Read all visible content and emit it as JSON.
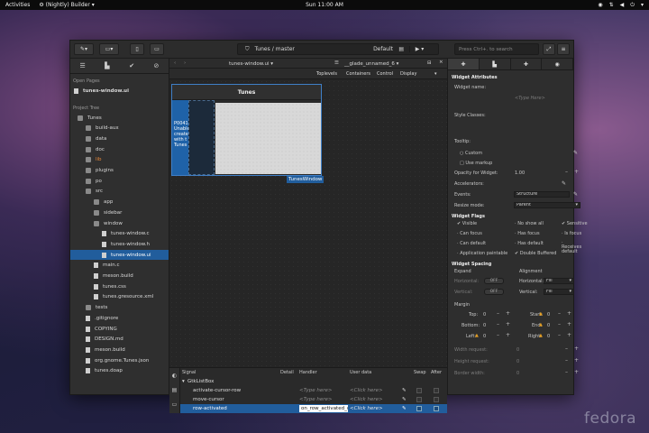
{
  "topbar": {
    "activities": "Activities",
    "app_menu": "(Nightly) Builder",
    "clock": "Sun 11:00 AM"
  },
  "headerbar": {
    "project": "Tunes",
    "branch": "master",
    "build_profile": "Default",
    "search_placeholder": "Press Ctrl+. to search"
  },
  "sidebar": {
    "open_pages_label": "Open Pages",
    "open_page": "tunes-window.ui",
    "project_tree_label": "Project Tree",
    "tree": [
      {
        "label": "Tunes",
        "kind": "folder",
        "indent": 0
      },
      {
        "label": "build-aux",
        "kind": "folder",
        "indent": 1
      },
      {
        "label": "data",
        "kind": "folder",
        "indent": 1
      },
      {
        "label": "doc",
        "kind": "folder",
        "indent": 1
      },
      {
        "label": "lib",
        "kind": "folder",
        "indent": 1,
        "highlight": true
      },
      {
        "label": "plugins",
        "kind": "folder",
        "indent": 1
      },
      {
        "label": "po",
        "kind": "folder",
        "indent": 1
      },
      {
        "label": "src",
        "kind": "folder",
        "indent": 1
      },
      {
        "label": "app",
        "kind": "folder",
        "indent": 2
      },
      {
        "label": "sidebar",
        "kind": "folder",
        "indent": 2
      },
      {
        "label": "window",
        "kind": "folder",
        "indent": 2
      },
      {
        "label": "tunes-window.c",
        "kind": "file",
        "indent": 3
      },
      {
        "label": "tunes-window.h",
        "kind": "file",
        "indent": 3
      },
      {
        "label": "tunes-window.ui",
        "kind": "file",
        "indent": 3,
        "selected": true
      },
      {
        "label": "main.c",
        "kind": "file",
        "indent": 2
      },
      {
        "label": "meson.build",
        "kind": "file",
        "indent": 2
      },
      {
        "label": "tunes.css",
        "kind": "file",
        "indent": 2
      },
      {
        "label": "tunes.gresource.xml",
        "kind": "file",
        "indent": 2
      },
      {
        "label": "tests",
        "kind": "folder",
        "indent": 1
      },
      {
        "label": ".gitignore",
        "kind": "file",
        "indent": 1
      },
      {
        "label": "COPYING",
        "kind": "file",
        "indent": 1
      },
      {
        "label": "DESIGN.md",
        "kind": "file",
        "indent": 1
      },
      {
        "label": "meson.build",
        "kind": "file",
        "indent": 1
      },
      {
        "label": "org.gnome.Tunes.json",
        "kind": "file",
        "indent": 1
      },
      {
        "label": "tunes.doap",
        "kind": "file",
        "indent": 1
      }
    ]
  },
  "editor": {
    "file_tab": "tunes-window.ui",
    "object_tab": "__glade_unnamed_6",
    "toolbar": [
      "Toplevels",
      "Containers",
      "Control",
      "Display"
    ],
    "preview_title": "Tunes",
    "preview_left_text": [
      "P0041",
      "Unable",
      "create",
      "with t",
      "Tunes"
    ],
    "preview_tag": "TunesWindow"
  },
  "signals": {
    "headers": [
      "Signal",
      "Detail",
      "Handler",
      "User data",
      "Swap",
      "After"
    ],
    "group": "GtkListBox",
    "rows": [
      {
        "signal": "activate-cursor-row",
        "handler": "<Type here>",
        "user_data": "<Click here>",
        "selected": false
      },
      {
        "signal": "move-cursor",
        "handler": "<Type here>",
        "user_data": "<Click here>",
        "selected": false
      },
      {
        "signal": "row-activated",
        "handler": "on_row_activated_cb",
        "user_data": "<Click here>",
        "selected": true
      }
    ]
  },
  "properties": {
    "title": "Widget Attributes",
    "widget_name_label": "Widget name:",
    "widget_name_placeholder": "<Type Here>",
    "style_classes_label": "Style Classes:",
    "tooltip_label": "Tooltip:",
    "custom_label": "Custom",
    "use_markup_label": "Use markup",
    "opacity_label": "Opacity for Widget:",
    "opacity_value": "1.00",
    "accelerators_label": "Accelerators:",
    "events_label": "Events:",
    "events_value": "Structure",
    "resize_label": "Resize mode:",
    "resize_value": "Parent",
    "flags_title": "Widget Flags",
    "flags": [
      {
        "label": "Visible",
        "checked": true
      },
      {
        "label": "No show all",
        "checked": false
      },
      {
        "label": "Sensitive",
        "checked": true
      },
      {
        "label": "Can focus",
        "checked": false
      },
      {
        "label": "Has focus",
        "checked": false
      },
      {
        "label": "Is focus",
        "checked": false
      },
      {
        "label": "Can default",
        "checked": false
      },
      {
        "label": "Has default",
        "checked": false
      },
      {
        "label": "Receives default",
        "checked": false
      },
      {
        "label": "Application paintable",
        "checked": false
      },
      {
        "label": "Double Buffered",
        "checked": true
      }
    ],
    "spacing_title": "Widget Spacing",
    "expand_label": "Expand",
    "alignment_label": "Alignment",
    "horizontal_label": "Horizontal:",
    "vertical_label": "Vertical:",
    "toggle_off": "OFF",
    "h_align": "Fill",
    "v_align": "Fill",
    "margin_label": "Margin",
    "margins": {
      "top": "Top:",
      "bottom": "Bottom:",
      "left": "Left:",
      "start": "Start:",
      "end": "End:",
      "right": "Right:"
    },
    "margin_value": "0",
    "width_request": "Width request:",
    "height_request": "Height request:",
    "border_width": "Border width:"
  },
  "watermark": "fedora",
  "colors": {
    "accent": "#215d9c",
    "warning": "#e8a020",
    "folder_highlight": "#e8883a"
  }
}
